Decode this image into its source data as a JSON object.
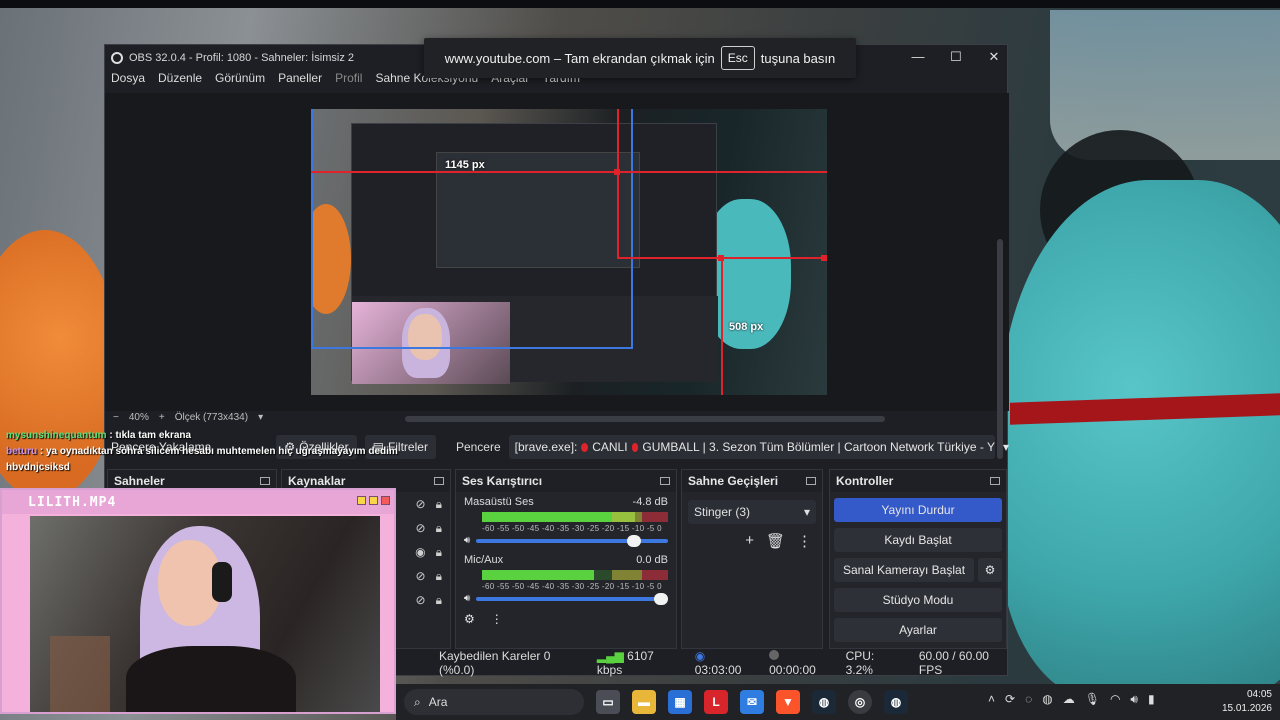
{
  "window": {
    "title": "OBS 32.0.4 - Profil: 1080 - Sahneler: İsimsiz 2",
    "controls": {
      "minimize": "—",
      "maximize": "☐",
      "close": "✕"
    }
  },
  "menu": [
    "Dosya",
    "Düzenle",
    "Görünüm",
    "Paneller",
    "Profil",
    "Sahne Koleksiyonu",
    "Araçlar",
    "Yardım"
  ],
  "fullscreen_toast": {
    "prefix": "www.youtube.com – Tam ekrandan çıkmak için",
    "key": "Esc",
    "suffix": "tuşuna basın"
  },
  "preview": {
    "width_label": "1145 px",
    "height_label": "508 px",
    "zoom": "40%",
    "scale_label": "Ölçek (773x434)"
  },
  "context_bar": {
    "source_name": "Pencere Yakalama",
    "properties": "Özellikler",
    "filters": "Filtreler",
    "window_label": "Pencere",
    "window_value_prefix": "[brave.exe]:",
    "window_value_live": "CANLI",
    "window_value_title": "GUMBALL | 3. Sezon Tüm Bölümler | Cartoon Network Türkiye - Y"
  },
  "docks": {
    "scenes": {
      "title": "Sahneler"
    },
    "sources": {
      "title": "Kaynaklar"
    },
    "mixer": {
      "title": "Ses Karıştırıcı",
      "scale": "-60 -55 -50 -45 -40 -35 -30 -25 -20 -15 -10 -5 0",
      "channels": [
        {
          "name": "Masaüstü Ses",
          "db": "-4.8 dB",
          "level": 0.82,
          "volume": 0.86
        },
        {
          "name": "Mic/Aux",
          "db": "0.0 dB",
          "level": 0.6,
          "volume": 1.0
        }
      ]
    },
    "transitions": {
      "title": "Sahne Geçişleri",
      "selected": "Stinger (3)"
    },
    "controls": {
      "title": "Kontroller",
      "stop_stream": "Yayını Durdur",
      "start_record": "Kaydı Başlat",
      "virtual_cam": "Sanal Kamerayı Başlat",
      "studio_mode": "Stüdyo Modu",
      "settings": "Ayarlar"
    }
  },
  "status": {
    "dropped": "Kaybedilen Kareler 0 (%0.0)",
    "bitrate": "6107 kbps",
    "stream_time": "03:03:00",
    "record_time": "00:00:00",
    "cpu": "CPU: 3.2%",
    "fps": "60.00 / 60.00 FPS"
  },
  "chat": [
    {
      "user": "mysunshinequantum",
      "message": ": tıkla tam ekrana"
    },
    {
      "user": "beturu",
      "message": ": ya oynadıktan sohra silicem hesabı muhtemelen hiç uğraşmayayım dedim"
    },
    {
      "user": "",
      "message": "hbvdnjcsiksd"
    }
  ],
  "webcam": {
    "title": "LILITH.MP4"
  },
  "taskbar": {
    "search_placeholder": "Ara",
    "clock_time": "04:05",
    "clock_date": "15.01.2026"
  },
  "colors": {
    "accent": "#3459c9",
    "live": "#e0232a",
    "meter_green": "#5ad13f",
    "webcam_frame": "#f3b1dc"
  }
}
